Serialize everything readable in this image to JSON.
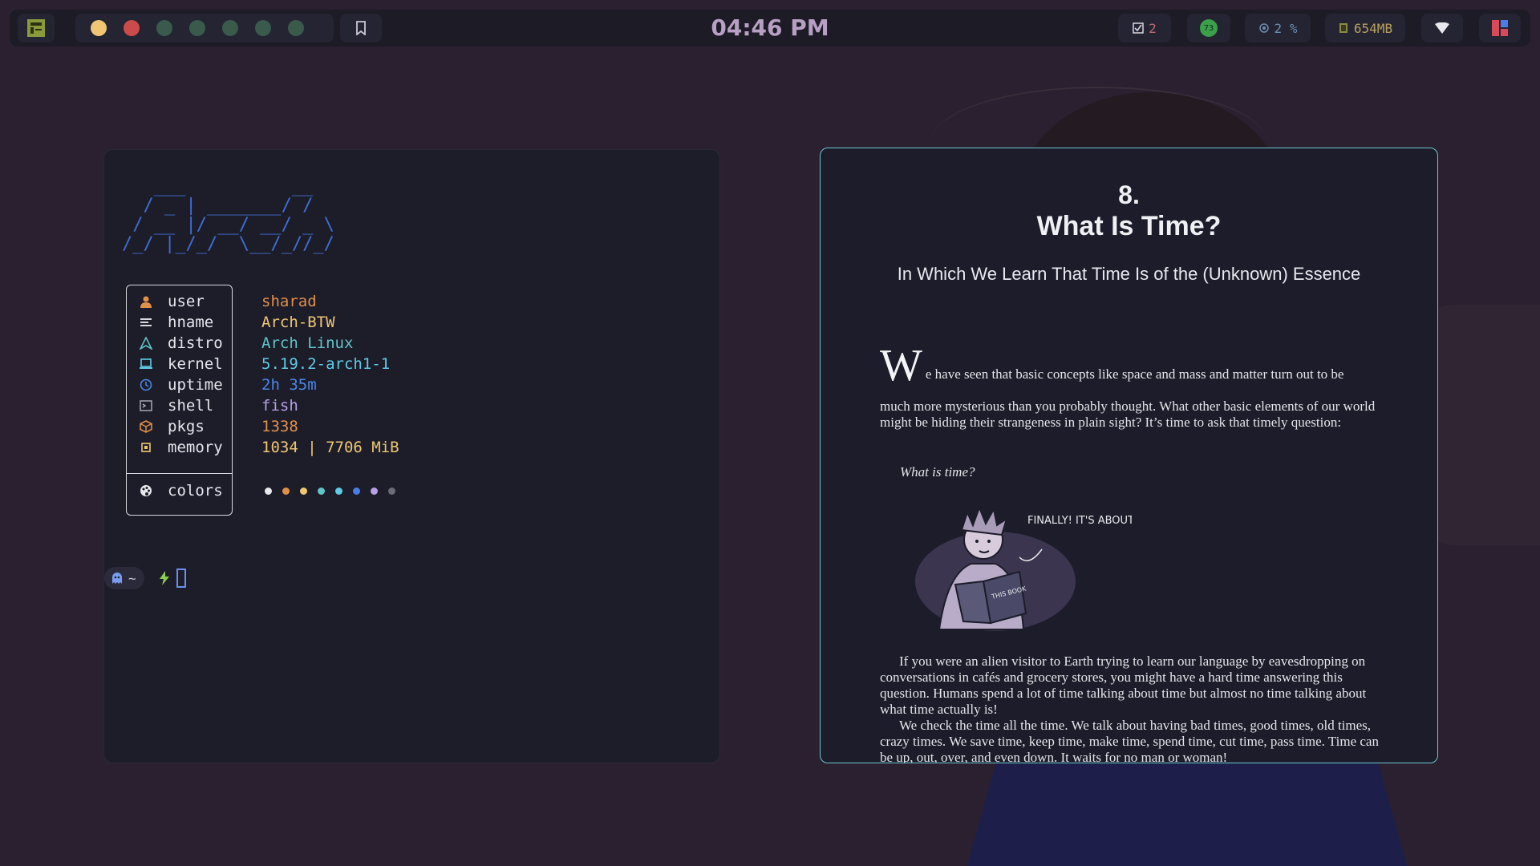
{
  "topbar": {
    "clock": "04:46 PM",
    "workspace_dots": [
      "#f0c674",
      "#cc4a4a",
      "#3a5a4c",
      "#3a5a4c",
      "#3a5a4c",
      "#3a5a4c",
      "#3a5a4c"
    ],
    "tasks_count": "2",
    "cpu": "2 %",
    "memory": "654MB",
    "update_count": "73"
  },
  "terminal": {
    "ascii_logo": "   ___          __\n  / _ | _______/ /\n / __ |/ __/ __/ _ \\\n/_/ |_/_/  \\__/_//_/",
    "info": [
      {
        "icon": "user-icon",
        "label": "user",
        "value": "sharad",
        "color": "#e0904a"
      },
      {
        "icon": "hostname-icon",
        "label": "hname",
        "value": "Arch-BTW",
        "color": "#f0c674"
      },
      {
        "icon": "distro-icon",
        "label": "distro",
        "value": "Arch Linux",
        "color": "#5ec4c8"
      },
      {
        "icon": "laptop-icon",
        "label": "kernel",
        "value": "5.19.2-arch1-1",
        "color": "#5ecbe8"
      },
      {
        "icon": "clock-icon",
        "label": "uptime",
        "value": "2h 35m",
        "color": "#4a86e8"
      },
      {
        "icon": "terminal-icon",
        "label": "shell",
        "value": "fish",
        "color": "#b7a0e8"
      },
      {
        "icon": "package-icon",
        "label": "pkgs",
        "value": "1338",
        "color": "#e0904a"
      },
      {
        "icon": "chip-icon",
        "label": "memory",
        "value": "1034 | 7706 MiB",
        "color": "#f0c674"
      }
    ],
    "colors_label": "colors",
    "palette": [
      "#e8e8ee",
      "#e0904a",
      "#f0c674",
      "#5ec4c8",
      "#5ecbe8",
      "#4a7de8",
      "#b7a0e8",
      "#6a6a78"
    ],
    "prompt_dir": "~"
  },
  "book": {
    "chapter_number": "8.",
    "chapter_title": "What Is Time?",
    "subtitle": "In Which We Learn That Time Is of the (Unknown) Essence",
    "dropcap": "W",
    "para1_first": "e have seen that basic concepts like space and mass and matter turn out to be",
    "para1_rest": "much more mysterious than you probably thought. What other basic elements of our world might be hiding their strangeness in plain sight? It’s time to ask that timely question:",
    "quote": "What is time?",
    "comic_speech": "FINALLY! IT'S ABOUT TIME!",
    "comic_book_label": "THIS BOOK",
    "para2": "If you were an alien visitor to Earth trying to learn our language by eavesdropping on conversations in cafés and grocery stores, you might have a hard time answering this question. Humans spend a lot of time talking about time but almost no time talking about what time actually is!",
    "para3": "We check the time all the time. We talk about having bad times, good times, old times, crazy times. We save time, keep time, make time, spend time, cut time, pass time. Time can be up, out, over, and even down. It waits for no man or woman!"
  }
}
